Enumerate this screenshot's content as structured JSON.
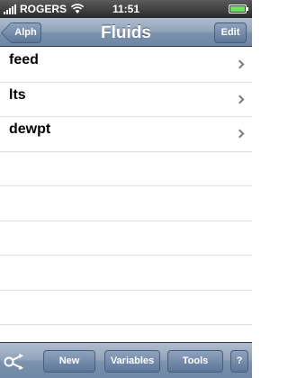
{
  "status_bar": {
    "carrier": "ROGERS",
    "time": "11:51",
    "battery_level": 1.0,
    "colors": {
      "battery_fill": "#6fe05a"
    }
  },
  "nav_bar": {
    "title": "Fluids",
    "back_label": "Alph",
    "edit_label": "Edit"
  },
  "list": {
    "items": [
      {
        "label": "feed"
      },
      {
        "label": "lts"
      },
      {
        "label": "dewpt"
      }
    ]
  },
  "toolbar": {
    "share_icon": "share-arrows-icon",
    "new_label": "New",
    "variables_label": "Variables",
    "tools_label": "Tools",
    "help_label": "?"
  },
  "colors": {
    "bar_top": "#b0bdcf",
    "bar_bottom": "#6e86a3",
    "button": "#5c7698"
  }
}
